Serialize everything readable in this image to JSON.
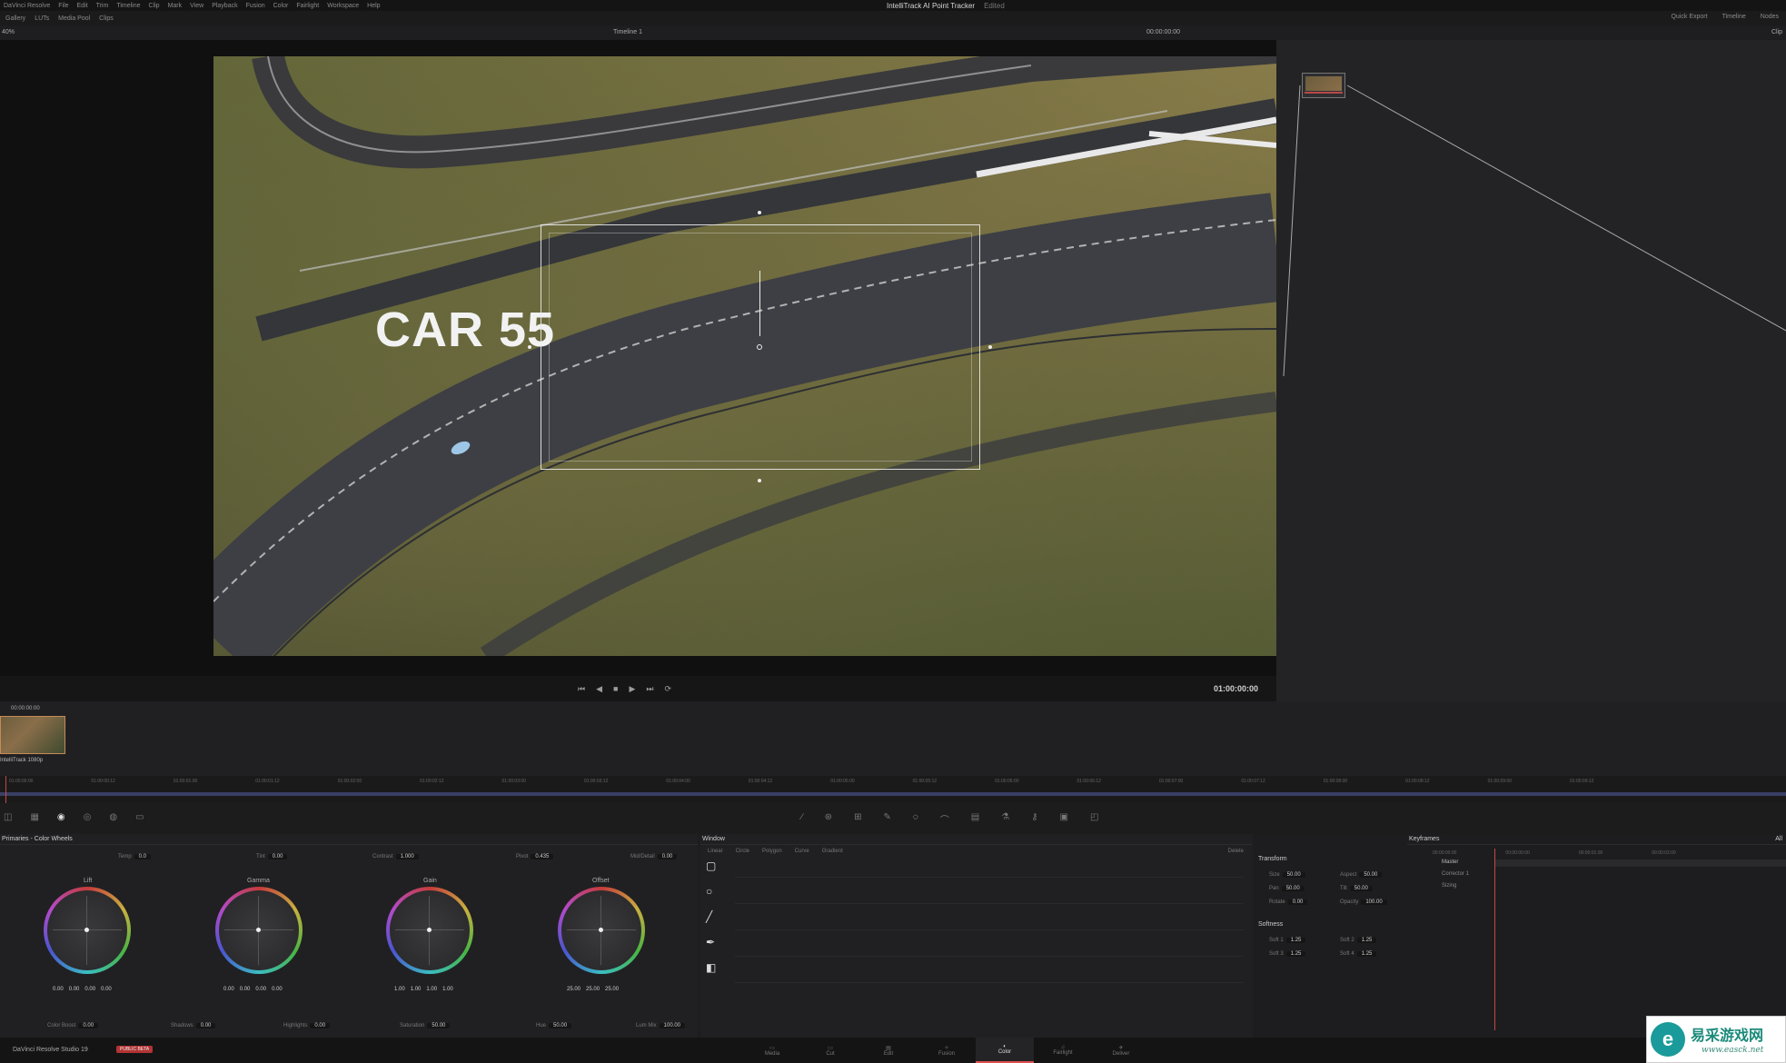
{
  "menubar": {
    "items": [
      "DaVinci Resolve",
      "File",
      "Edit",
      "Trim",
      "Timeline",
      "Clip",
      "Mark",
      "View",
      "Playback",
      "Fusion",
      "Color",
      "Fairlight",
      "Workspace",
      "Help"
    ],
    "project_title": "IntelliTrack AI Point Tracker",
    "project_status": "Edited"
  },
  "toolbar": {
    "left_items": [
      "Gallery",
      "LUTs",
      "Media Pool",
      "Clips"
    ],
    "right_items": [
      "Quick Export",
      "Timeline",
      "Nodes"
    ]
  },
  "viewer": {
    "zoom": "40%",
    "timeline_name": "Timeline 1",
    "timecode": "00:00:00:00",
    "right_label": "Clip"
  },
  "overlay_text": "CAR 55",
  "transport": {
    "timecode": "01:00:00:00",
    "buttons": [
      "⏮",
      "◀",
      "■",
      "▶",
      "⏭",
      "⟳"
    ]
  },
  "clips": {
    "timecode": "00:00:00:00",
    "clip_number": "01",
    "clip_name": "IntelliTrack 1080p"
  },
  "ruler": {
    "ticks": [
      "01:00:00:00",
      "01:00:00:12",
      "01:00:01:00",
      "01:00:01:12",
      "01:00:02:00",
      "01:00:02:12",
      "01:00:03:00",
      "01:00:03:12",
      "01:00:04:00",
      "01:00:04:12",
      "01:00:05:00",
      "01:00:05:12",
      "01:00:06:00",
      "01:00:06:12",
      "01:00:07:00",
      "01:00:07:12",
      "01:00:08:00",
      "01:00:08:12",
      "01:00:09:00",
      "01:00:09:12"
    ]
  },
  "color_panel": {
    "title": "Primaries - Color Wheels",
    "top_params": [
      {
        "label": "Temp",
        "value": "0.0"
      },
      {
        "label": "Tint",
        "value": "0.00"
      },
      {
        "label": "Contrast",
        "value": "1.000"
      },
      {
        "label": "Pivot",
        "value": "0.435"
      },
      {
        "label": "Mid/Detail",
        "value": "0.00"
      }
    ],
    "wheels": [
      {
        "label": "Lift",
        "values": [
          "0.00",
          "0.00",
          "0.00",
          "0.00"
        ]
      },
      {
        "label": "Gamma",
        "values": [
          "0.00",
          "0.00",
          "0.00",
          "0.00"
        ]
      },
      {
        "label": "Gain",
        "values": [
          "1.00",
          "1.00",
          "1.00",
          "1.00"
        ]
      },
      {
        "label": "Offset",
        "values": [
          "25.00",
          "25.00",
          "25.00"
        ]
      }
    ],
    "bottom_params": [
      {
        "label": "Color Boost",
        "value": "0.00"
      },
      {
        "label": "Shadows",
        "value": "0.00"
      },
      {
        "label": "Highlights",
        "value": "0.00"
      },
      {
        "label": "Saturation",
        "value": "50.00"
      },
      {
        "label": "Hue",
        "value": "50.00"
      },
      {
        "label": "Lum Mix",
        "value": "100.00"
      }
    ]
  },
  "window_panel": {
    "title": "Window",
    "tabs": [
      "Linear",
      "Circle",
      "Polygon",
      "Curve",
      "Gradient"
    ],
    "delete_label": "Delete"
  },
  "transform_panel": {
    "title": "Transform",
    "rows": [
      {
        "l1": "Size",
        "v1": "50.00",
        "l2": "Aspect",
        "v2": "50.00"
      },
      {
        "l1": "Pan",
        "v1": "50.00",
        "l2": "Tilt",
        "v2": "50.00"
      },
      {
        "l1": "Rotate",
        "v1": "0.00",
        "l2": "Opacity",
        "v2": "100.00"
      }
    ],
    "softness_title": "Softness",
    "soft_rows": [
      {
        "l1": "Soft 1",
        "v1": "1.25",
        "l2": "Soft 2",
        "v2": "1.25"
      },
      {
        "l1": "Soft 3",
        "v1": "1.25",
        "l2": "Soft 4",
        "v2": "1.25"
      }
    ]
  },
  "keyframes": {
    "title": "Keyframes",
    "filter": "All",
    "tracks": [
      "Master",
      "Corrector 1",
      "Sizing"
    ],
    "timecodes": [
      "00:00:00:00",
      "00:00:00:00",
      "00:00:01:00",
      "00:00:02:00"
    ]
  },
  "pagebar": {
    "brand": "DaVinci Resolve Studio 19",
    "beta": "PUBLIC BETA",
    "pages": [
      "Media",
      "Cut",
      "Edit",
      "Fusion",
      "Color",
      "Fairlight",
      "Deliver"
    ],
    "active": "Color"
  },
  "watermark": {
    "chinese": "易采游戏网",
    "url": "www.easck.net"
  },
  "colors": {
    "accent": "#e05050",
    "track_box": "#e8e8e8",
    "timeline_bar": "#3a3f66"
  }
}
